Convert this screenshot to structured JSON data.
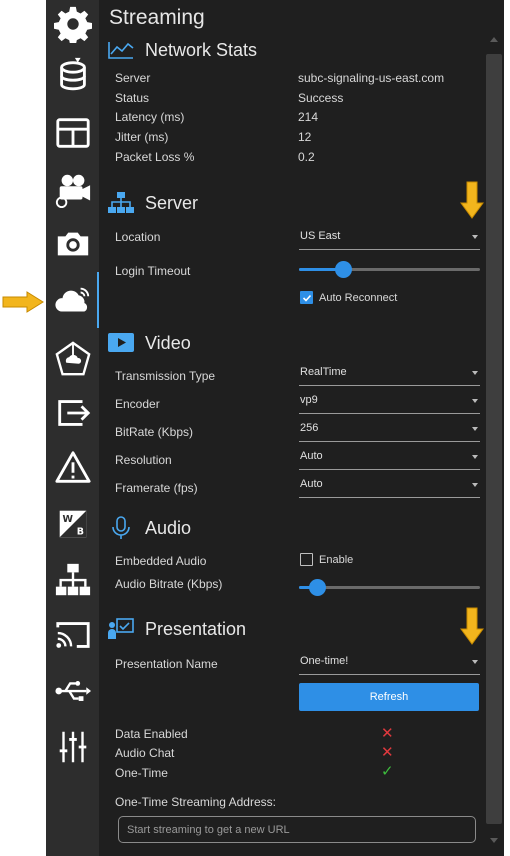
{
  "page": {
    "title": "Streaming"
  },
  "sidebar": {
    "items": [
      {
        "name": "settings-gear-icon"
      },
      {
        "name": "database-icon"
      },
      {
        "name": "layout-icon"
      },
      {
        "name": "camera-settings-icon"
      },
      {
        "name": "photo-camera-icon"
      },
      {
        "name": "cloud-streaming-icon"
      },
      {
        "name": "network-pentagon-icon"
      },
      {
        "name": "export-icon"
      },
      {
        "name": "warning-icon"
      },
      {
        "name": "whitebalance-icon"
      },
      {
        "name": "network-tree-icon"
      },
      {
        "name": "cast-icon"
      },
      {
        "name": "usb-icon"
      },
      {
        "name": "equalizer-icon"
      }
    ],
    "active_index": 5
  },
  "network_stats": {
    "title": "Network Stats",
    "rows": [
      {
        "label": "Server",
        "value": "subc-signaling-us-east.com"
      },
      {
        "label": "Status",
        "value": "Success"
      },
      {
        "label": "Latency (ms)",
        "value": "214"
      },
      {
        "label": "Jitter (ms)",
        "value": "12"
      },
      {
        "label": "Packet Loss %",
        "value": "0.2"
      }
    ]
  },
  "server": {
    "title": "Server",
    "location_label": "Location",
    "location_value": "US East",
    "login_timeout_label": "Login Timeout",
    "login_timeout_level": 0.22,
    "auto_reconnect_label": "Auto Reconnect",
    "auto_reconnect_checked": true
  },
  "video": {
    "title": "Video",
    "transmission_type_label": "Transmission Type",
    "transmission_type_value": "RealTime",
    "encoder_label": "Encoder",
    "encoder_value": "vp9",
    "bitrate_label": "BitRate (Kbps)",
    "bitrate_value": "256",
    "resolution_label": "Resolution",
    "resolution_value": "Auto",
    "framerate_label": "Framerate (fps)",
    "framerate_value": "Auto"
  },
  "audio": {
    "title": "Audio",
    "embedded_label": "Embedded Audio",
    "enable_label": "Enable",
    "enable_checked": false,
    "bitrate_label": "Audio Bitrate (Kbps)",
    "bitrate_level": 0.06
  },
  "presentation": {
    "title": "Presentation",
    "name_label": "Presentation Name",
    "name_value": "One-time!",
    "refresh_label": "Refresh",
    "data_enabled_label": "Data Enabled",
    "audio_chat_label": "Audio Chat",
    "one_time_label": "One-Time",
    "status_marks": {
      "data_enabled": "✕",
      "audio_chat": "✕",
      "one_time": "✓"
    },
    "streaming_address_label": "One-Time Streaming Address:",
    "streaming_address_placeholder": "Start streaming to get a new URL"
  },
  "colors": {
    "accent": "#2e8fe6",
    "panel_bg": "#1f1f1f",
    "sidebar_bg": "#2d2d2d",
    "annotation_arrow": "#f2b51d",
    "error": "#e0393e",
    "success": "#3dbb3d"
  }
}
